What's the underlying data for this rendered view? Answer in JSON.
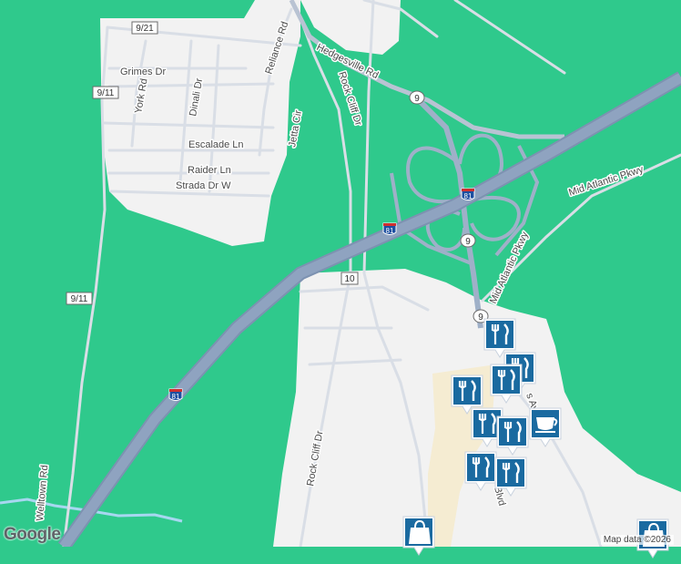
{
  "colors": {
    "background": "#2fc98c",
    "developed": "#f2f2f2",
    "commercial": "#f5ecd2",
    "highway": "#8fa3c0",
    "highway_edge": "#7d92b1",
    "local_road": "#d9dee6",
    "water": "#a7d7f0",
    "pin": "#1a6aa0",
    "pin_border": "#ffffff"
  },
  "streets": {
    "hedgesville": "Hedgesville Rd",
    "reliance": "Reliance Rd",
    "grimes": "Grimes Dr",
    "york": "York Rd",
    "dinali": "Dinali Dr",
    "rock_cliff_top": "Rock Cliff Dr",
    "jetta": "Jetta Cir",
    "escalade": "Escalade Ln",
    "raider": "Raider Ln",
    "strada": "Strada Dr W",
    "mid_atlantic_1": "Mid Atlantic Pkwy",
    "mid_atlantic_2": "Mid Atlantic Pkwy",
    "welltown": "Welltown Rd",
    "rock_cliff_bottom": "Rock Cliff Dr",
    "blvd": "Blvd",
    "ave_fragment": "s Av"
  },
  "shields": {
    "route_921": "9/21",
    "route_911a": "9/11",
    "route_911b": "9/11",
    "route_10": "10",
    "route_9a": "9",
    "route_9b": "9",
    "route_9c": "9",
    "i81a": "81",
    "i81b": "81",
    "i81c": "81"
  },
  "pins": [
    {
      "icon": "restaurant-icon",
      "name": "restaurant-pin-1"
    },
    {
      "icon": "restaurant-icon",
      "name": "restaurant-pin-2"
    },
    {
      "icon": "restaurant-icon",
      "name": "restaurant-pin-3"
    },
    {
      "icon": "restaurant-icon",
      "name": "restaurant-pin-4"
    },
    {
      "icon": "restaurant-icon",
      "name": "restaurant-pin-5"
    },
    {
      "icon": "restaurant-icon",
      "name": "restaurant-pin-6"
    },
    {
      "icon": "restaurant-icon",
      "name": "restaurant-pin-7"
    },
    {
      "icon": "cafe-icon",
      "name": "cafe-pin"
    },
    {
      "icon": "restaurant-icon",
      "name": "restaurant-pin-8"
    },
    {
      "icon": "shopping-bag-icon",
      "name": "shopping-pin-1"
    },
    {
      "icon": "shopping-bag-icon",
      "name": "shopping-pin-2"
    },
    {
      "icon": "shopping-bag-icon",
      "name": "shopping-pin-3"
    }
  ],
  "branding": {
    "logo": "Google",
    "attribution": "Map data ©2026"
  }
}
